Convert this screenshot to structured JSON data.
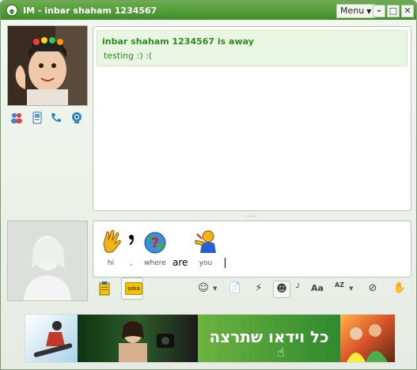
{
  "window": {
    "title": "IM - inbar shaham 1234567",
    "menu_label": "Menu",
    "minimize_label": "–",
    "maximize_label": "□",
    "close_label": "✕"
  },
  "status": {
    "title": "inbar shaham 1234567 is away",
    "message": "testing :) :("
  },
  "splitter": "....",
  "compose": {
    "emotes": [
      {
        "name": "hi",
        "label": "hi"
      },
      {
        "name": "comma",
        "label": ","
      },
      {
        "name": "where",
        "label": "where"
      },
      {
        "name": "you",
        "label": "you"
      }
    ],
    "typed_word": "are"
  },
  "toolbar": {
    "sms_label": "sms",
    "font_icon_label": "Aa",
    "spell_icon_label": "AZ"
  },
  "banner": {
    "text": "כל וידאו שתרצה"
  },
  "colors": {
    "title_green": "#3f8d2a",
    "status_green": "#2e8b1f"
  }
}
